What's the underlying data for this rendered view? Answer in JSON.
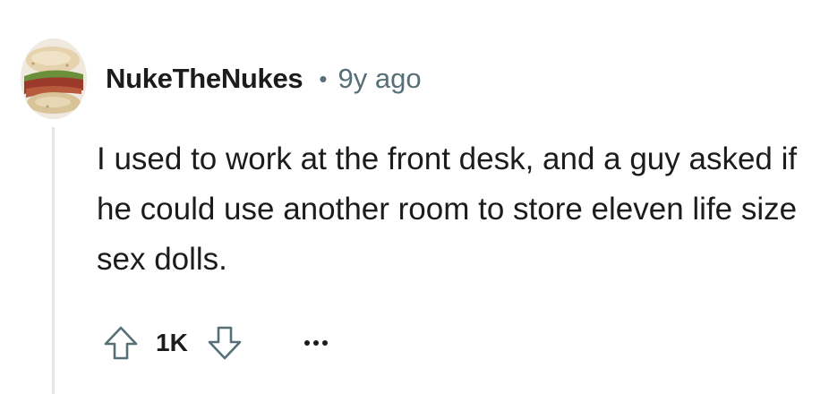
{
  "comment": {
    "username": "NukeTheNukes",
    "separator": "•",
    "timestamp": "9y ago",
    "avatar": "sandwich-avatar",
    "body": "I used to work at the front desk, and a guy asked if he could use another room to store eleven life size sex dolls.",
    "score": "1K"
  },
  "icons": {
    "upvote": "arrow-up-icon",
    "downvote": "arrow-down-icon",
    "more": "more-options-icon"
  },
  "colors": {
    "text": "#1c1c1c",
    "meta": "#576f76",
    "thread_line": "#e4e6e8",
    "icon_stroke": "#576f76"
  }
}
